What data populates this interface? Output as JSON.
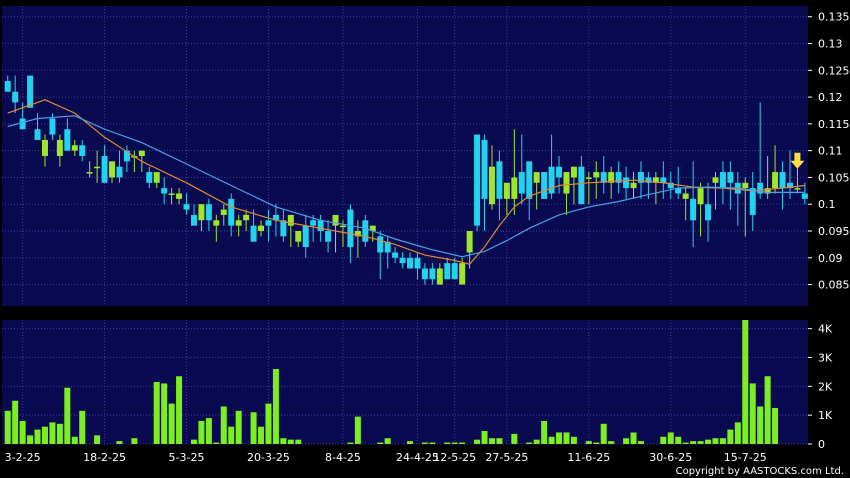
{
  "copyright": "Copyright by AASTOCKS.com Ltd.",
  "colors": {
    "plot_bg": "#0a0a50",
    "grid": "#3a3aa0",
    "up": "#9ee62a",
    "down": "#22d3f0",
    "ma_short": "#e08a30",
    "ma_long": "#4ca0e8",
    "volume": "#7cf01e",
    "marker": "#ffe040",
    "axis_text": "#ffffff"
  },
  "chart_data": [
    {
      "type": "candlestick",
      "ylim": [
        0.081,
        0.137
      ],
      "y_ticks": [
        0.085,
        0.09,
        0.095,
        0.1,
        0.105,
        0.11,
        0.115,
        0.12,
        0.125,
        0.13,
        0.135
      ],
      "y_tick_labels": [
        "0.085",
        "0.09",
        "0.095",
        "0.1",
        "0.105",
        "0.11",
        "0.115",
        "0.12",
        "0.125",
        "0.13",
        "0.135"
      ],
      "x_tick_labels": [
        "3-2-25",
        "18-2-25",
        "5-3-25",
        "20-3-25",
        "8-4-25",
        "24-4-25",
        "12-5-25",
        "27-5-25",
        "11-6-25",
        "30-6-25",
        "15-7-25"
      ],
      "x_tick_index": [
        2,
        13,
        24,
        35,
        45,
        55,
        60,
        67,
        78,
        89,
        99
      ],
      "grid": true,
      "series": [
        {
          "kind": "ohlc",
          "open": [
            0.123,
            0.121,
            0.116,
            0.124,
            0.114,
            0.109,
            0.116,
            0.109,
            0.114,
            0.11,
            0.111,
            0.106,
            0.107,
            0.109,
            0.105,
            0.107,
            0.11,
            0.109,
            0.109,
            0.106,
            0.104,
            0.103,
            0.102,
            0.101,
            0.1,
            0.098,
            0.097,
            0.1,
            0.096,
            0.098,
            0.101,
            0.096,
            0.097,
            0.096,
            0.095,
            0.097,
            0.098,
            0.097,
            0.096,
            0.093,
            0.096,
            0.097,
            0.097,
            0.095,
            0.096,
            0.096,
            0.099,
            0.094,
            0.097,
            0.095,
            0.094,
            0.093,
            0.091,
            0.09,
            0.09,
            0.09,
            0.088,
            0.088,
            0.085,
            0.089,
            0.089,
            0.085,
            0.091,
            0.113,
            0.112,
            0.1,
            0.108,
            0.101,
            0.101,
            0.106,
            0.108,
            0.104,
            0.106,
            0.107,
            0.107,
            0.102,
            0.105,
            0.107,
            0.105,
            0.105,
            0.106,
            0.104,
            0.106,
            0.105,
            0.103,
            0.106,
            0.105,
            0.104,
            0.105,
            0.104,
            0.103,
            0.101,
            0.101,
            0.1,
            0.1,
            0.104,
            0.106,
            0.106,
            0.104,
            0.103,
            0.103,
            0.104,
            0.102,
            0.103,
            0.106,
            0.104,
            0.103,
            0.102
          ],
          "high": [
            0.124,
            0.124,
            0.119,
            0.124,
            0.117,
            0.113,
            0.117,
            0.113,
            0.116,
            0.112,
            0.112,
            0.108,
            0.11,
            0.111,
            0.107,
            0.11,
            0.111,
            0.11,
            0.11,
            0.107,
            0.106,
            0.105,
            0.103,
            0.103,
            0.102,
            0.1,
            0.1,
            0.101,
            0.098,
            0.1,
            0.102,
            0.098,
            0.099,
            0.099,
            0.097,
            0.099,
            0.1,
            0.099,
            0.098,
            0.095,
            0.098,
            0.098,
            0.098,
            0.097,
            0.098,
            0.097,
            0.1,
            0.097,
            0.098,
            0.096,
            0.095,
            0.094,
            0.092,
            0.091,
            0.091,
            0.091,
            0.089,
            0.089,
            0.089,
            0.09,
            0.09,
            0.09,
            0.094,
            0.113,
            0.113,
            0.111,
            0.11,
            0.104,
            0.114,
            0.113,
            0.108,
            0.106,
            0.106,
            0.113,
            0.109,
            0.106,
            0.107,
            0.109,
            0.106,
            0.108,
            0.109,
            0.107,
            0.108,
            0.107,
            0.106,
            0.108,
            0.106,
            0.106,
            0.108,
            0.106,
            0.107,
            0.103,
            0.108,
            0.104,
            0.104,
            0.106,
            0.108,
            0.108,
            0.106,
            0.105,
            0.106,
            0.119,
            0.109,
            0.111,
            0.108,
            0.11,
            0.108,
            0.104
          ],
          "low": [
            0.121,
            0.117,
            0.114,
            0.118,
            0.112,
            0.107,
            0.112,
            0.107,
            0.11,
            0.109,
            0.108,
            0.105,
            0.104,
            0.104,
            0.104,
            0.104,
            0.106,
            0.106,
            0.106,
            0.103,
            0.103,
            0.1,
            0.1,
            0.1,
            0.098,
            0.096,
            0.095,
            0.095,
            0.093,
            0.096,
            0.094,
            0.094,
            0.095,
            0.094,
            0.094,
            0.093,
            0.094,
            0.093,
            0.092,
            0.092,
            0.09,
            0.093,
            0.093,
            0.091,
            0.091,
            0.092,
            0.089,
            0.09,
            0.092,
            0.093,
            0.086,
            0.088,
            0.089,
            0.088,
            0.088,
            0.086,
            0.085,
            0.085,
            0.085,
            0.086,
            0.087,
            0.085,
            0.088,
            0.095,
            0.095,
            0.099,
            0.097,
            0.098,
            0.098,
            0.1,
            0.097,
            0.099,
            0.101,
            0.101,
            0.102,
            0.098,
            0.1,
            0.102,
            0.1,
            0.101,
            0.102,
            0.101,
            0.102,
            0.101,
            0.101,
            0.101,
            0.101,
            0.1,
            0.101,
            0.101,
            0.101,
            0.097,
            0.092,
            0.094,
            0.093,
            0.099,
            0.1,
            0.099,
            0.096,
            0.094,
            0.095,
            0.101,
            0.101,
            0.102,
            0.099,
            0.101,
            0.102,
            0.1
          ],
          "close": [
            0.121,
            0.119,
            0.114,
            0.118,
            0.112,
            0.112,
            0.113,
            0.112,
            0.11,
            0.111,
            0.109,
            0.106,
            0.107,
            0.104,
            0.108,
            0.105,
            0.108,
            0.109,
            0.11,
            0.104,
            0.106,
            0.102,
            0.102,
            0.102,
            0.099,
            0.096,
            0.1,
            0.097,
            0.097,
            0.099,
            0.096,
            0.097,
            0.098,
            0.093,
            0.096,
            0.096,
            0.097,
            0.094,
            0.098,
            0.095,
            0.092,
            0.096,
            0.095,
            0.093,
            0.098,
            0.096,
            0.092,
            0.095,
            0.093,
            0.096,
            0.091,
            0.091,
            0.09,
            0.089,
            0.088,
            0.088,
            0.086,
            0.086,
            0.088,
            0.086,
            0.086,
            0.089,
            0.095,
            0.096,
            0.101,
            0.107,
            0.101,
            0.104,
            0.105,
            0.102,
            0.101,
            0.106,
            0.101,
            0.102,
            0.105,
            0.106,
            0.107,
            0.1,
            0.105,
            0.106,
            0.104,
            0.106,
            0.104,
            0.103,
            0.104,
            0.104,
            0.104,
            0.105,
            0.104,
            0.103,
            0.102,
            0.102,
            0.097,
            0.103,
            0.097,
            0.105,
            0.103,
            0.104,
            0.102,
            0.104,
            0.098,
            0.102,
            0.103,
            0.106,
            0.103,
            0.103,
            0.103,
            0.101
          ]
        },
        {
          "kind": "moving_average",
          "color": "#e08a30",
          "points": [
            [
              0,
              0.117
            ],
            [
              5,
              0.1195
            ],
            [
              9,
              0.117
            ],
            [
              13,
              0.1125
            ],
            [
              18,
              0.108
            ],
            [
              24,
              0.104
            ],
            [
              30,
              0.0995
            ],
            [
              36,
              0.097
            ],
            [
              40,
              0.096
            ],
            [
              44,
              0.095
            ],
            [
              48,
              0.094
            ],
            [
              52,
              0.0925
            ],
            [
              56,
              0.0905
            ],
            [
              60,
              0.0895
            ],
            [
              62,
              0.0888
            ],
            [
              64,
              0.092
            ],
            [
              66,
              0.096
            ],
            [
              68,
              0.0995
            ],
            [
              70,
              0.1015
            ],
            [
              74,
              0.1035
            ],
            [
              78,
              0.104
            ],
            [
              84,
              0.1045
            ],
            [
              88,
              0.104
            ],
            [
              92,
              0.1032
            ],
            [
              96,
              0.103
            ],
            [
              100,
              0.1025
            ],
            [
              104,
              0.103
            ],
            [
              107,
              0.1035
            ]
          ]
        },
        {
          "kind": "moving_average",
          "color": "#4ca0e8",
          "points": [
            [
              0,
              0.1145
            ],
            [
              4,
              0.116
            ],
            [
              9,
              0.1165
            ],
            [
              13,
              0.114
            ],
            [
              18,
              0.1115
            ],
            [
              24,
              0.1075
            ],
            [
              30,
              0.1035
            ],
            [
              36,
              0.0995
            ],
            [
              42,
              0.097
            ],
            [
              48,
              0.0955
            ],
            [
              52,
              0.0935
            ],
            [
              57,
              0.0915
            ],
            [
              61,
              0.0902
            ],
            [
              64,
              0.0912
            ],
            [
              67,
              0.0932
            ],
            [
              70,
              0.0955
            ],
            [
              74,
              0.098
            ],
            [
              78,
              0.0995
            ],
            [
              82,
              0.1005
            ],
            [
              86,
              0.1018
            ],
            [
              90,
              0.103
            ],
            [
              94,
              0.1032
            ],
            [
              98,
              0.103
            ],
            [
              102,
              0.1022
            ],
            [
              107,
              0.1022
            ]
          ]
        }
      ],
      "annotation": {
        "type": "arrow-down",
        "index": 106,
        "value": 0.107
      }
    },
    {
      "type": "bar",
      "ylim": [
        0,
        4300
      ],
      "y_ticks": [
        0,
        1000,
        2000,
        3000,
        4000
      ],
      "y_tick_labels": [
        "0",
        "1K",
        "2K",
        "3K",
        "4K"
      ],
      "grid": true,
      "values": [
        1150,
        1500,
        800,
        300,
        500,
        600,
        750,
        700,
        1950,
        250,
        1150,
        0,
        300,
        0,
        0,
        100,
        0,
        200,
        0,
        0,
        2150,
        2100,
        1400,
        2350,
        0,
        150,
        800,
        900,
        50,
        1300,
        600,
        1150,
        0,
        1100,
        600,
        1400,
        2600,
        200,
        150,
        150,
        0,
        0,
        0,
        0,
        0,
        0,
        50,
        950,
        0,
        0,
        50,
        200,
        0,
        0,
        100,
        0,
        50,
        50,
        0,
        50,
        50,
        50,
        0,
        150,
        450,
        200,
        200,
        0,
        350,
        0,
        50,
        150,
        800,
        250,
        400,
        400,
        250,
        0,
        100,
        50,
        700,
        100,
        0,
        200,
        400,
        100,
        0,
        0,
        250,
        400,
        250,
        50,
        100,
        100,
        150,
        200,
        200,
        500,
        750,
        4300,
        2100,
        1300,
        2350,
        1250
      ]
    }
  ]
}
